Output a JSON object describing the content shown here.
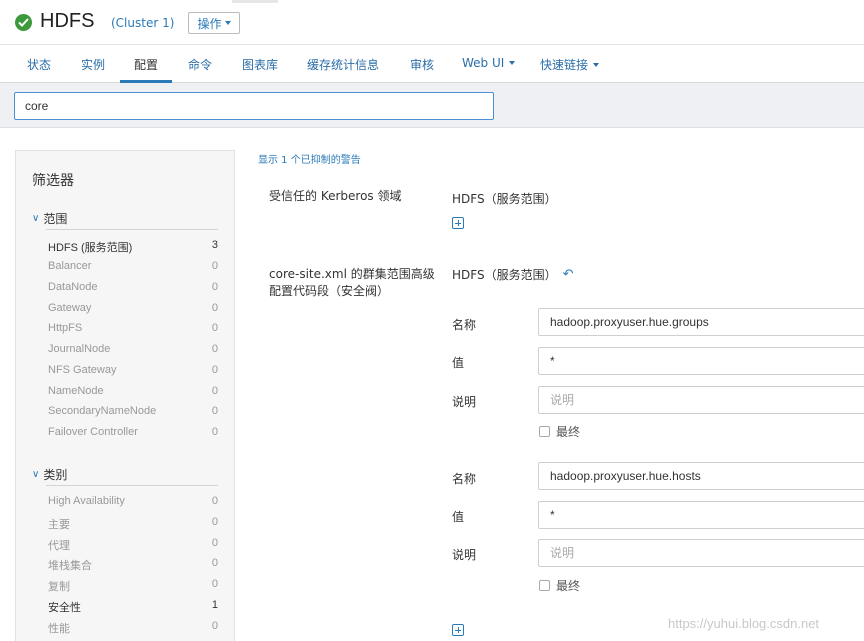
{
  "header": {
    "service_name": "HDFS",
    "cluster": "(Cluster 1)",
    "actions_label": "操作"
  },
  "nav": {
    "tabs": [
      {
        "label": "状态"
      },
      {
        "label": "实例"
      },
      {
        "label": "配置"
      },
      {
        "label": "命令"
      },
      {
        "label": "图表库"
      },
      {
        "label": "缓存统计信息"
      },
      {
        "label": "审核"
      },
      {
        "label": "Web UI"
      },
      {
        "label": "快速链接"
      }
    ],
    "active": "配置"
  },
  "search": {
    "value": "core"
  },
  "filters": {
    "title": "筛选器",
    "scope": {
      "heading": "范围",
      "items": [
        {
          "label": "HDFS (服务范围)",
          "count": "3"
        },
        {
          "label": "Balancer",
          "count": "0"
        },
        {
          "label": "DataNode",
          "count": "0"
        },
        {
          "label": "Gateway",
          "count": "0"
        },
        {
          "label": "HttpFS",
          "count": "0"
        },
        {
          "label": "JournalNode",
          "count": "0"
        },
        {
          "label": "NFS Gateway",
          "count": "0"
        },
        {
          "label": "NameNode",
          "count": "0"
        },
        {
          "label": "SecondaryNameNode",
          "count": "0"
        },
        {
          "label": "Failover Controller",
          "count": "0"
        }
      ]
    },
    "category": {
      "heading": "类别",
      "items": [
        {
          "label": "High Availability",
          "count": "0"
        },
        {
          "label": "主要",
          "count": "0"
        },
        {
          "label": "代理",
          "count": "0"
        },
        {
          "label": "堆栈集合",
          "count": "0"
        },
        {
          "label": "复制",
          "count": "0"
        },
        {
          "label": "安全性",
          "count": "1"
        },
        {
          "label": "性能",
          "count": "0"
        }
      ]
    }
  },
  "main": {
    "suppressed_warning_link": "显示 1 个已抑制的警告",
    "kerberos": {
      "label": "受信任的 Kerberos 领域",
      "scope": "HDFS（服务范围）"
    },
    "core_site": {
      "label": "core-site.xml 的群集范围高级配置代码段（安全阀）",
      "scope": "HDFS（服务范围）",
      "name_label": "名称",
      "value_label": "值",
      "desc_label": "说明",
      "final_label": "最终",
      "desc_placeholder": "说明",
      "entries": [
        {
          "name": "hadoop.proxyuser.hue.groups",
          "value": "*"
        },
        {
          "name": "hadoop.proxyuser.hue.hosts",
          "value": "*"
        }
      ]
    }
  },
  "watermark": "https://yuhui.blog.csdn.net",
  "colors": {
    "accent": "#2a7ab8",
    "status_ok": "#3c9a3c"
  }
}
